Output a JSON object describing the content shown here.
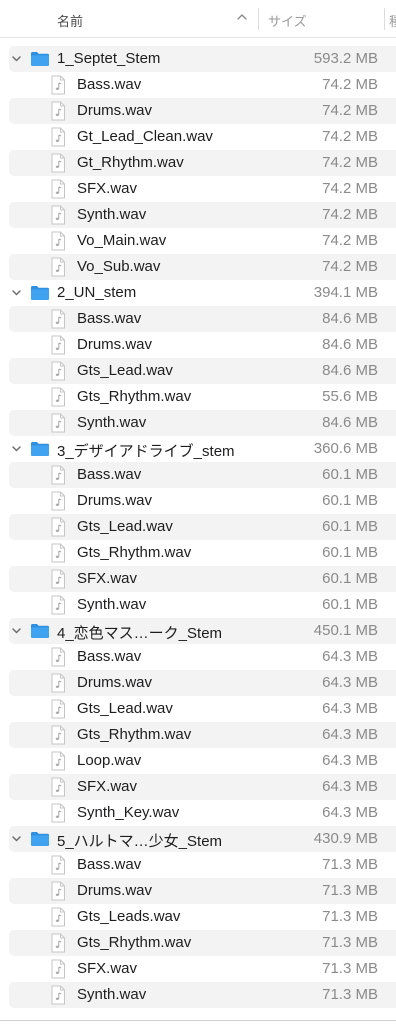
{
  "header": {
    "name_label": "名前",
    "size_label": "サイズ",
    "more_label": "種",
    "sort_icon": "chevron-up-icon"
  },
  "colors": {
    "folder": "#3fa3f2",
    "stripe": "#f3f3f3",
    "size_text": "#8a8a8a"
  },
  "rows": [
    {
      "kind": "folder",
      "name": "1_Septet_Stem",
      "size": "593.2 MB",
      "expanded": true
    },
    {
      "kind": "file",
      "name": "Bass.wav",
      "size": "74.2 MB"
    },
    {
      "kind": "file",
      "name": "Drums.wav",
      "size": "74.2 MB"
    },
    {
      "kind": "file",
      "name": "Gt_Lead_Clean.wav",
      "size": "74.2 MB"
    },
    {
      "kind": "file",
      "name": "Gt_Rhythm.wav",
      "size": "74.2 MB"
    },
    {
      "kind": "file",
      "name": "SFX.wav",
      "size": "74.2 MB"
    },
    {
      "kind": "file",
      "name": "Synth.wav",
      "size": "74.2 MB"
    },
    {
      "kind": "file",
      "name": "Vo_Main.wav",
      "size": "74.2 MB"
    },
    {
      "kind": "file",
      "name": "Vo_Sub.wav",
      "size": "74.2 MB"
    },
    {
      "kind": "folder",
      "name": "2_UN_stem",
      "size": "394.1 MB",
      "expanded": true
    },
    {
      "kind": "file",
      "name": "Bass.wav",
      "size": "84.6 MB"
    },
    {
      "kind": "file",
      "name": "Drums.wav",
      "size": "84.6 MB"
    },
    {
      "kind": "file",
      "name": "Gts_Lead.wav",
      "size": "84.6 MB"
    },
    {
      "kind": "file",
      "name": "Gts_Rhythm.wav",
      "size": "55.6 MB"
    },
    {
      "kind": "file",
      "name": "Synth.wav",
      "size": "84.6 MB"
    },
    {
      "kind": "folder",
      "name": "3_デザイアドライブ_stem",
      "size": "360.6 MB",
      "expanded": true
    },
    {
      "kind": "file",
      "name": "Bass.wav",
      "size": "60.1 MB"
    },
    {
      "kind": "file",
      "name": "Drums.wav",
      "size": "60.1 MB"
    },
    {
      "kind": "file",
      "name": "Gts_Lead.wav",
      "size": "60.1 MB"
    },
    {
      "kind": "file",
      "name": "Gts_Rhythm.wav",
      "size": "60.1 MB"
    },
    {
      "kind": "file",
      "name": "SFX.wav",
      "size": "60.1 MB"
    },
    {
      "kind": "file",
      "name": "Synth.wav",
      "size": "60.1 MB"
    },
    {
      "kind": "folder",
      "name": "4_恋色マス…ーク_Stem",
      "size": "450.1 MB",
      "expanded": true
    },
    {
      "kind": "file",
      "name": "Bass.wav",
      "size": "64.3 MB"
    },
    {
      "kind": "file",
      "name": "Drums.wav",
      "size": "64.3 MB"
    },
    {
      "kind": "file",
      "name": "Gts_Lead.wav",
      "size": "64.3 MB"
    },
    {
      "kind": "file",
      "name": "Gts_Rhythm.wav",
      "size": "64.3 MB"
    },
    {
      "kind": "file",
      "name": "Loop.wav",
      "size": "64.3 MB"
    },
    {
      "kind": "file",
      "name": "SFX.wav",
      "size": "64.3 MB"
    },
    {
      "kind": "file",
      "name": "Synth_Key.wav",
      "size": "64.3 MB"
    },
    {
      "kind": "folder",
      "name": "5_ハルトマ…少女_Stem",
      "size": "430.9 MB",
      "expanded": true
    },
    {
      "kind": "file",
      "name": "Bass.wav",
      "size": "71.3 MB"
    },
    {
      "kind": "file",
      "name": "Drums.wav",
      "size": "71.3 MB"
    },
    {
      "kind": "file",
      "name": "Gts_Leads.wav",
      "size": "71.3 MB"
    },
    {
      "kind": "file",
      "name": "Gts_Rhythm.wav",
      "size": "71.3 MB"
    },
    {
      "kind": "file",
      "name": "SFX.wav",
      "size": "71.3 MB"
    },
    {
      "kind": "file",
      "name": "Synth.wav",
      "size": "71.3 MB"
    }
  ]
}
